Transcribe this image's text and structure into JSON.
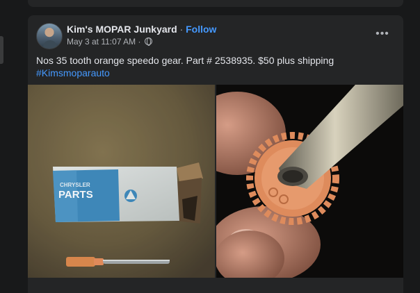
{
  "post": {
    "author": "Kim's MOPAR Junkyard",
    "separator": "·",
    "follow_label": "Follow",
    "timestamp": "May 3 at 11:07 AM",
    "meta_separator": "·",
    "audience_icon": "globe-icon",
    "more_icon": "more-options-icon",
    "more_glyph": "•••",
    "caption": "Nos 35 tooth orange speedo gear. Part # 2538935. $50 plus shipping",
    "hashtag": "#Kimsmoparauto"
  },
  "photos": {
    "left": {
      "box_brand_line1": "CHRYSLER",
      "box_brand_line2": "PARTS"
    }
  },
  "colors": {
    "background": "#18191a",
    "card": "#242526",
    "text_primary": "#e4e6eb",
    "text_secondary": "#b0b3b8",
    "link": "#4599ff",
    "gear_orange": "#e08a5a"
  }
}
